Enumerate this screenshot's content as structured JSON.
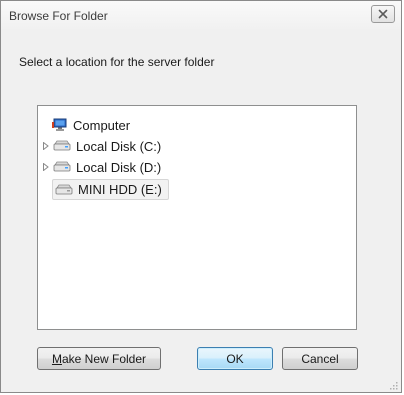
{
  "window": {
    "title": "Browse For Folder",
    "close_icon": "close-icon"
  },
  "prompt": "Select a location for the server folder",
  "tree": {
    "items": [
      {
        "label": "Computer",
        "icon": "computer-icon",
        "expandable": false,
        "selected": false
      },
      {
        "label": "Local Disk (C:)",
        "icon": "drive-icon",
        "expandable": true,
        "selected": false
      },
      {
        "label": "Local Disk (D:)",
        "icon": "drive-icon",
        "expandable": true,
        "selected": false
      },
      {
        "label": "MINI HDD (E:)",
        "icon": "drive-icon",
        "expandable": false,
        "selected": true
      }
    ]
  },
  "buttons": {
    "make_new_folder": {
      "mnemonic": "M",
      "rest": "ake New Folder"
    },
    "ok": "OK",
    "cancel": "Cancel"
  },
  "colors": {
    "dialog_bg": "#f0f0f0",
    "default_button_border": "#3c7fb1",
    "selection_bg": "#f2f2f2"
  }
}
